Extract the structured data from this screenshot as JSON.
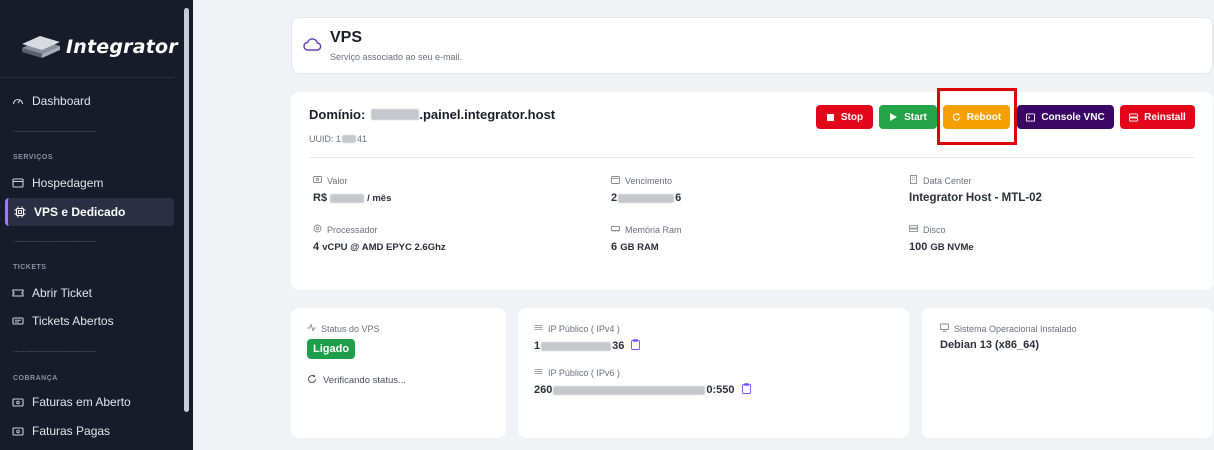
{
  "sidebar": {
    "brand": "Integrator",
    "items": [
      {
        "label": "Dashboard",
        "icon": "gauge-icon"
      },
      {
        "label": "Hospedagem",
        "icon": "window-icon"
      },
      {
        "label": "VPS e Dedicado",
        "icon": "cpu-icon"
      },
      {
        "label": "Abrir Ticket",
        "icon": "ticket-icon"
      },
      {
        "label": "Tickets Abertos",
        "icon": "tickets-icon"
      },
      {
        "label": "Faturas em Aberto",
        "icon": "invoice-icon"
      },
      {
        "label": "Faturas Pagas",
        "icon": "invoice-paid-icon"
      }
    ],
    "sections": {
      "servicos": "SERVIÇOS",
      "tickets": "TICKETS",
      "cobranca": "COBRANÇA"
    },
    "separator": "------------------------------"
  },
  "header": {
    "title": "VPS",
    "subtitle": "Serviço associado ao seu e-mail."
  },
  "vps": {
    "domain_label": "Domínio:",
    "domain_suffix": ".painel.integrator.host",
    "uuid_label": "UUID: 1",
    "uuid_suffix": "41",
    "buttons": {
      "stop": "Stop",
      "start": "Start",
      "reboot": "Reboot",
      "console": "Console VNC",
      "reinstall": "Reinstall"
    },
    "valor_label": "Valor",
    "valor_prefix": "R$",
    "valor_suffix": "/ mês",
    "vencimento_label": "Vencimento",
    "vencimento_prefix": "2",
    "vencimento_suffix": "6",
    "datacenter_label": "Data Center",
    "datacenter_value": "Integrator Host - MTL-02",
    "processador_label": "Processador",
    "processador_num": "4",
    "processador_value": "vCPU @ AMD EPYC 2.6Ghz",
    "memoria_label": "Memória Ram",
    "memoria_num": "6",
    "memoria_value": "GB RAM",
    "disco_label": "Disco",
    "disco_num": "100",
    "disco_value": "GB NVMe"
  },
  "status": {
    "label": "Status do VPS",
    "badge": "Ligado",
    "checking": "Verificando status..."
  },
  "network": {
    "ipv4_label": "IP Público ( IPv4 )",
    "ipv4_prefix": "1",
    "ipv4_suffix": "36",
    "ipv6_label": "IP Público ( IPv6 )",
    "ipv6_prefix": "260",
    "ipv6_suffix": "0:550"
  },
  "os": {
    "label": "Sistema Operacional Instalado",
    "value": "Debian 13 (x86_64)"
  },
  "colors": {
    "sidebar_bg": "#171b2a",
    "stop": "#e3061b",
    "start": "#22a447",
    "reboot": "#f59f00",
    "console": "#3b0764",
    "status_on": "#1e9e4a",
    "highlight": "#e00000"
  }
}
